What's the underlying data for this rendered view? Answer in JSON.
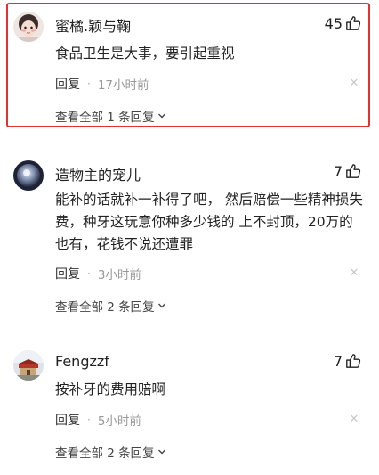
{
  "comments": [
    {
      "username": "蜜橘.颖与鞠",
      "likes": "45",
      "text": "食品卫生是大事，要引起重视",
      "reply_label": "回复",
      "time": "17小时前",
      "view_all": "查看全部 1 条回复"
    },
    {
      "username": "造物主的宠儿",
      "likes": "7",
      "text": "能补的话就补一补得了吧， 然后赔偿一些精神损失费，种牙这玩意你种多少钱的 上不封顶，20万的也有，花钱不说还遭罪",
      "reply_label": "回复",
      "time": "3小时前",
      "view_all": "查看全部 2 条回复"
    },
    {
      "username": "Fengzzf",
      "likes": "7",
      "text": "按补牙的费用赔啊",
      "reply_label": "回复",
      "time": "5小时前",
      "view_all": "查看全部 2 条回复"
    }
  ],
  "colors": {
    "highlight": "#e53030",
    "muted": "#999999"
  },
  "icons": {
    "like": "thumbs-up-icon",
    "close": "close-icon",
    "expand": "chevron-down-icon"
  }
}
